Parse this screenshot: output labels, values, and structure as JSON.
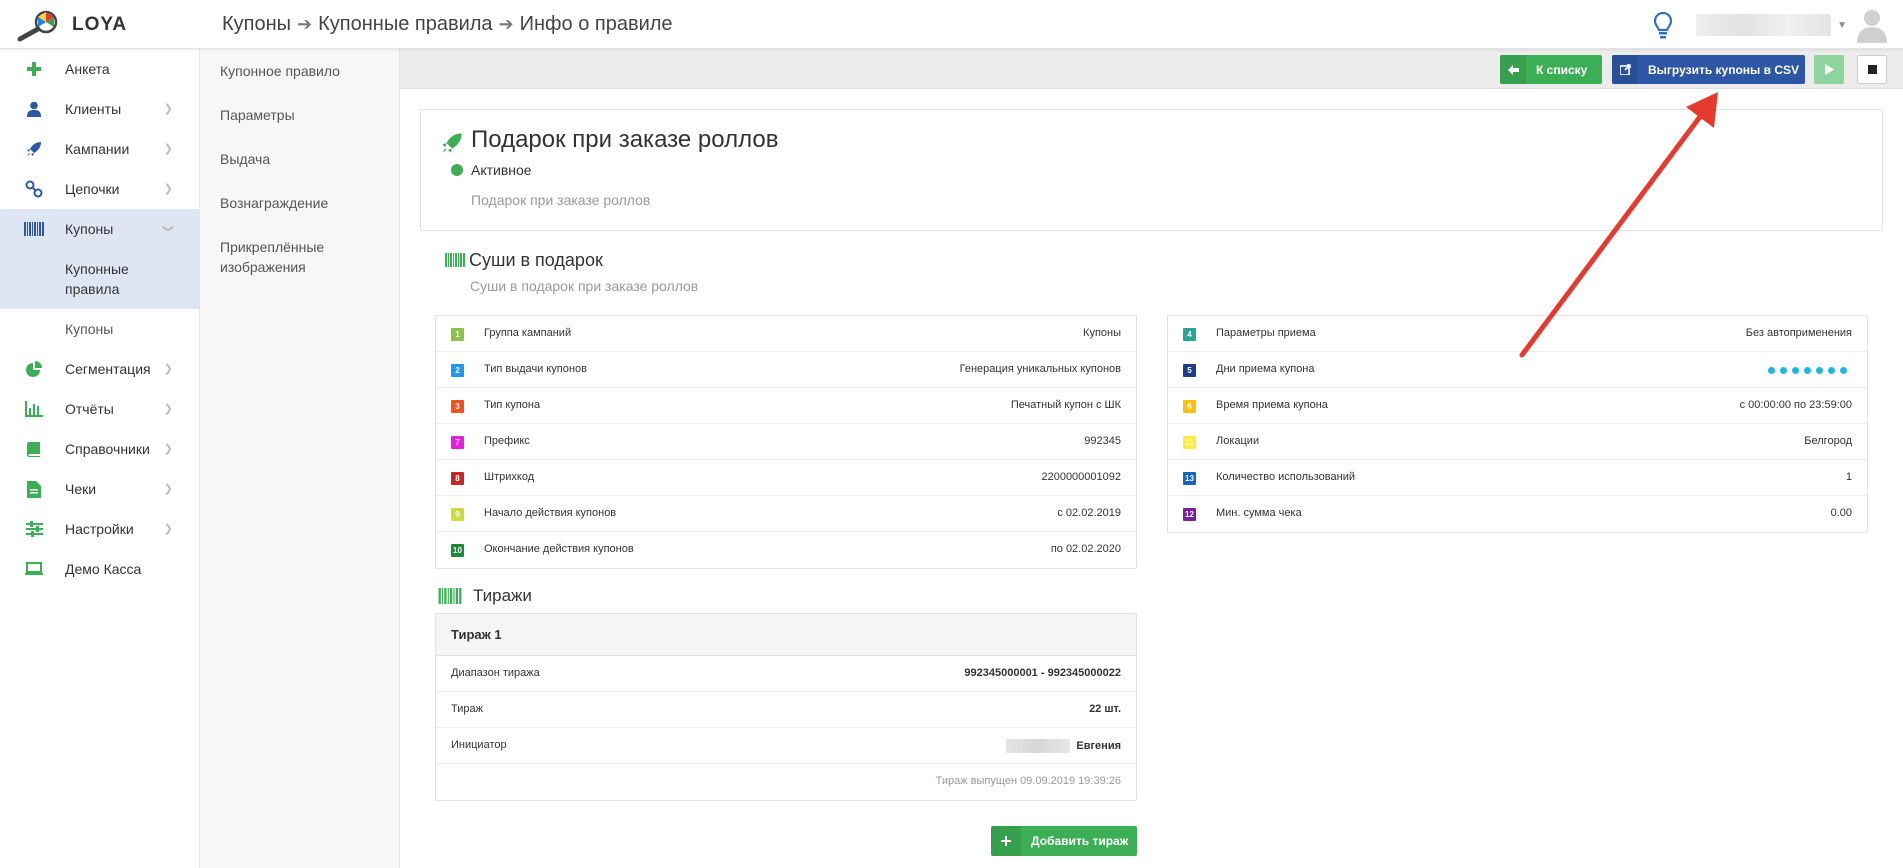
{
  "app": {
    "name": "LOYA"
  },
  "breadcrumb": [
    "Купоны",
    "Купонные правила",
    "Инфо о правиле"
  ],
  "sidebar": {
    "items": [
      {
        "label": "Анкета",
        "icon": "plus-icon",
        "chevron": false
      },
      {
        "label": "Клиенты",
        "icon": "user-icon",
        "chevron": true
      },
      {
        "label": "Кампании",
        "icon": "rocket-icon",
        "chevron": true
      },
      {
        "label": "Цепочки",
        "icon": "link-icon",
        "chevron": true
      },
      {
        "label": "Купоны",
        "icon": "barcode-icon",
        "chevron": true,
        "active": true
      }
    ],
    "sub_items": [
      "Купонные правила",
      "Купоны"
    ],
    "items_after": [
      {
        "label": "Сегментация",
        "icon": "pie-chart-icon"
      },
      {
        "label": "Отчёты",
        "icon": "bar-chart-icon"
      },
      {
        "label": "Справочники",
        "icon": "book-icon"
      },
      {
        "label": "Чеки",
        "icon": "receipt-icon"
      },
      {
        "label": "Настройки",
        "icon": "sliders-icon"
      },
      {
        "label": "Демо Касса",
        "icon": "laptop-icon"
      }
    ]
  },
  "subnav": [
    "Купонное правило",
    "Параметры",
    "Выдача",
    "Вознаграждение",
    "Прикреплённые изображения"
  ],
  "toolbar": {
    "back_label": "К списку",
    "export_label": "Выгрузить купоны в CSV"
  },
  "rule": {
    "title": "Подарок при заказе роллов",
    "status": "Активное",
    "description": "Подарок при заказе роллов"
  },
  "campaign": {
    "title": "Суши в подарок",
    "subtitle": "Суши в подарок при заказе роллов"
  },
  "left_params": [
    {
      "num": "1",
      "color": "#8bc34a",
      "label": "Группа кампаний",
      "value": "Купоны"
    },
    {
      "num": "2",
      "color": "#2196f3",
      "label": "Тип выдачи купонов",
      "value": "Генерация уникальных купонов"
    },
    {
      "num": "3",
      "color": "#f4511e",
      "label": "Тип купона",
      "value": "Печатный купон с ШК"
    },
    {
      "num": "7",
      "color": "#e91ee0",
      "label": "Префикс",
      "value": "992345"
    },
    {
      "num": "8",
      "color": "#c62828",
      "label": "Штрихкод",
      "value": "2200000001092"
    },
    {
      "num": "9",
      "color": "#cddc39",
      "label": "Начало действия купонов",
      "value": "с 02.02.2019"
    },
    {
      "num": "10",
      "color": "#1b8a3a",
      "label": "Окончание действия купонов",
      "value": "по 02.02.2020"
    }
  ],
  "right_params": [
    {
      "num": "4",
      "color": "#26a69a",
      "label": "Параметры приема",
      "value": "Без автоприменения"
    },
    {
      "num": "5",
      "color": "#1a3d8f",
      "label": "Дни приема купона",
      "value": ""
    },
    {
      "num": "6",
      "color": "#ffc107",
      "label": "Время приема купона",
      "value": "с 00:00:00 по 23:59:00"
    },
    {
      "num": "11",
      "color": "#ffeb3b",
      "label": "Локации",
      "value": "Белгород"
    },
    {
      "num": "13",
      "color": "#1565c0",
      "label": "Количество использований",
      "value": "1"
    },
    {
      "num": "12",
      "color": "#7b1fa2",
      "label": "Мин. сумма чека",
      "value": "0.00"
    }
  ],
  "days_accept_count": 7,
  "tirazhi": {
    "title": "Тиражи",
    "batch_title": "Тираж 1",
    "rows": [
      {
        "label": "Диапазон тиража",
        "value": "992345000001 - 992345000022"
      },
      {
        "label": "Тираж",
        "value": "22 шт."
      },
      {
        "label": "Инициатор",
        "value": "Евгения"
      }
    ],
    "footer": "Тираж выпущен 09.09.2019 19:39:26",
    "add_label": "Добавить тираж"
  },
  "colors": {
    "green": "#3cae55",
    "blue": "#2d57a4",
    "accent_red": "#e53a30"
  }
}
